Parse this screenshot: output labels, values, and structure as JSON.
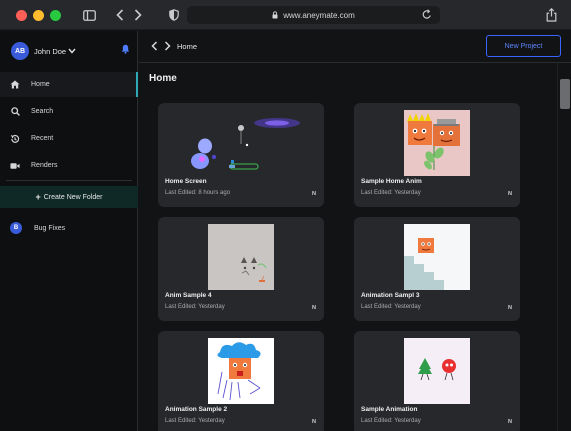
{
  "browser": {
    "url": "www.aneymate.com",
    "icons": [
      "sidebar-icon",
      "back-icon",
      "forward-icon",
      "shield-icon",
      "lock-icon",
      "reload-icon",
      "share-icon"
    ]
  },
  "sidebar": {
    "user": {
      "initials": "AB",
      "name": "John Doe"
    },
    "items": [
      {
        "label": "Home",
        "icon": "home-icon",
        "active": true
      },
      {
        "label": "Search",
        "icon": "search-icon",
        "active": false
      },
      {
        "label": "Recent",
        "icon": "history-icon",
        "active": false
      },
      {
        "label": "Renders",
        "icon": "video-icon",
        "active": false
      }
    ],
    "create_folder": "Create New Folder",
    "folders": [
      {
        "initial": "B",
        "label": "Bug Fixes"
      }
    ]
  },
  "topbar": {
    "breadcrumb": "Home",
    "new_project": "New Project"
  },
  "main": {
    "title": "Home",
    "accent_color": "#3a64ff",
    "projects": [
      {
        "title": "Home Screen",
        "meta": "Last Edited: 8 hours ago",
        "badge": "N"
      },
      {
        "title": "Sample Home Anim",
        "meta": "Last Edited: Yesterday",
        "badge": "N"
      },
      {
        "title": "Anim Sample 4",
        "meta": "Last Edited: Yesterday",
        "badge": "N"
      },
      {
        "title": "Animation Sampl 3",
        "meta": "Last Edited: Yesterday",
        "badge": "N"
      },
      {
        "title": "Animation Sample 2",
        "meta": "Last Edited: Yesterday",
        "badge": "N"
      },
      {
        "title": "Sample Animation",
        "meta": "Last Edited: Yesterday",
        "badge": "N"
      }
    ]
  }
}
